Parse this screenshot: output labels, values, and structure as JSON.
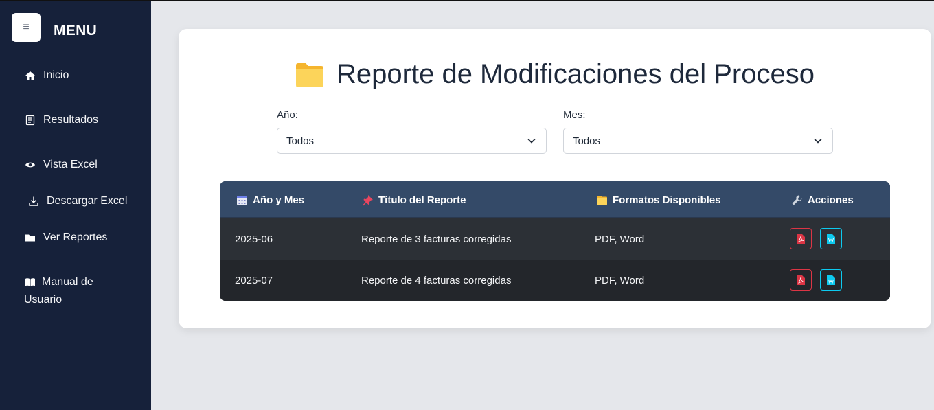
{
  "sidebar": {
    "menu_title": "MENU",
    "toggle_glyph": "≡",
    "items": [
      {
        "label": "Inicio",
        "icon": "home-icon"
      },
      {
        "label": "Resultados",
        "icon": "receipt-icon"
      },
      {
        "label": "Vista Excel",
        "icon": "eye-icon"
      },
      {
        "label": "Descargar Excel",
        "icon": "download-icon"
      },
      {
        "label": "Ver Reportes",
        "icon": "folder-icon"
      },
      {
        "label": "Manual de Usuario",
        "icon": "book-icon"
      }
    ]
  },
  "main": {
    "title": "Reporte de Modificaciones del Proceso",
    "title_icon": "folder-icon",
    "filters": {
      "year_label": "Año:",
      "year_value": "Todos",
      "month_label": "Mes:",
      "month_value": "Todos"
    },
    "table": {
      "headers": [
        {
          "label": "Año y Mes",
          "icon": "calendar-icon"
        },
        {
          "label": "Título del Reporte",
          "icon": "pushpin-icon"
        },
        {
          "label": "Formatos Disponibles",
          "icon": "folder-icon"
        },
        {
          "label": "Acciones",
          "icon": "wrench-icon"
        }
      ],
      "rows": [
        {
          "period": "2025-06",
          "title": "Reporte de 3 facturas corregidas",
          "formats": "PDF, Word"
        },
        {
          "period": "2025-07",
          "title": "Reporte de 4 facturas corregidas",
          "formats": "PDF, Word"
        }
      ]
    }
  },
  "colors": {
    "sidebar_bg": "#16213a",
    "table_header_bg": "#344a68",
    "pdf_accent": "#dc3545",
    "word_accent": "#0dcaf0"
  }
}
